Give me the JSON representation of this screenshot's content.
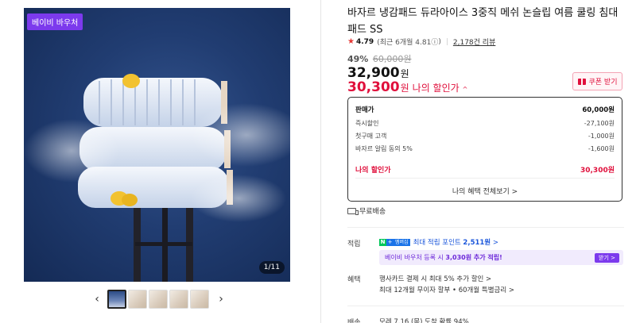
{
  "gallery": {
    "badge": "베이비 바우처",
    "counter": "1/11",
    "prev_arrow": "‹",
    "next_arrow": "›",
    "thumb_count": 5
  },
  "product": {
    "title": "바자르 냉감패드 듀라아이스 3중직 메쉬 논슬립 여름 쿨링 침대패드 SS",
    "rating_score": "4.79",
    "rating_recent": "(최근 6개월 4.81",
    "rating_info_icon": "ⓘ",
    "rating_recent_close": ")",
    "review_count": "2,178건 리뷰",
    "discount_pct": "49%",
    "original_price": "60,000원",
    "price": "32,900",
    "price_won": "원",
    "my_price": "30,300",
    "my_price_won": "원",
    "my_price_label": "나의 할인가",
    "my_price_chevron": "^",
    "coupon_label": "쿠폰 받기"
  },
  "breakdown": {
    "rows": [
      {
        "label": "판매가",
        "value": "60,000원"
      },
      {
        "label": "즉시할인",
        "value": "-27,100원"
      },
      {
        "label": "첫구매 고객",
        "value": "-1,000원"
      },
      {
        "label": "바자르 알림 동의 5%",
        "value": "-1,600원"
      }
    ],
    "mine_label": "나의 할인가",
    "mine_value": "30,300원",
    "footer": "나의 혜택 전체보기 >"
  },
  "shipping": {
    "free_label": "무료배송"
  },
  "points": {
    "section_label": "적립",
    "npay_n": "N",
    "npay_plus": "+",
    "npay_member": "멤버십",
    "text_prefix": "최대 적립 포인트",
    "amount": "2,511원",
    "chevron": ">",
    "voucher_text_prefix": "베이비 바우처 등록 시",
    "voucher_amount": "3,030원 추가 적립!",
    "voucher_button": "받기 >"
  },
  "benefits": {
    "section_label": "혜택",
    "line1": "행사카드 결제 시 최대 5% 추가 할인 >",
    "line2": "최대 12개월 무이자 할부 • 60개월 특별금리 >"
  },
  "delivery": {
    "section_label": "배송",
    "line": "모레 7.16.(목) 도착 확률 94%"
  },
  "colors": {
    "accent_red": "#e0103c",
    "badge_purple": "#7c3aed",
    "points_blue": "#1a56db"
  }
}
